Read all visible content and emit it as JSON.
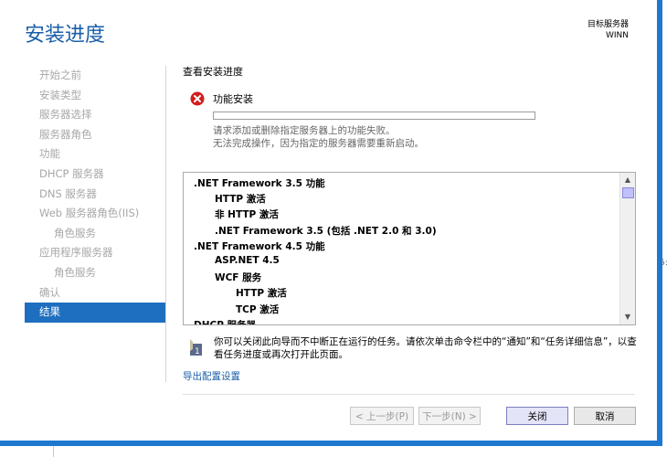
{
  "window": {
    "title": "安装进度",
    "server_label": "目标服务器",
    "server_name": "WINN"
  },
  "nav": {
    "items": [
      {
        "label": "开始之前",
        "indent": false,
        "active": false
      },
      {
        "label": "安装类型",
        "indent": false,
        "active": false
      },
      {
        "label": "服务器选择",
        "indent": false,
        "active": false
      },
      {
        "label": "服务器角色",
        "indent": false,
        "active": false
      },
      {
        "label": "功能",
        "indent": false,
        "active": false
      },
      {
        "label": "DHCP 服务器",
        "indent": false,
        "active": false
      },
      {
        "label": "DNS 服务器",
        "indent": false,
        "active": false
      },
      {
        "label": "Web 服务器角色(IIS)",
        "indent": false,
        "active": false
      },
      {
        "label": "角色服务",
        "indent": true,
        "active": false
      },
      {
        "label": "应用程序服务器",
        "indent": false,
        "active": false
      },
      {
        "label": "角色服务",
        "indent": true,
        "active": false
      },
      {
        "label": "确认",
        "indent": false,
        "active": false
      },
      {
        "label": "结果",
        "indent": false,
        "active": true
      }
    ]
  },
  "main": {
    "section_title": "查看安装进度",
    "feature_label": "功能安装",
    "status_icon": "error-x-icon",
    "status_color": "#d31e1e",
    "progress": 0,
    "fail_line1": "请求添加或删除指定服务器上的功能失败。",
    "fail_line2": "无法完成操作，因为指定的服务器需要重新启动。"
  },
  "list": {
    "items": [
      {
        "text": ".NET Framework 3.5 功能",
        "level": 0
      },
      {
        "text": "HTTP 激活",
        "level": 1
      },
      {
        "text": "非 HTTP 激活",
        "level": 1
      },
      {
        "text": ".NET Framework 3.5 (包括 .NET 2.0 和 3.0)",
        "level": 1
      },
      {
        "text": ".NET Framework 4.5 功能",
        "level": 0
      },
      {
        "text": "ASP.NET 4.5",
        "level": 1
      },
      {
        "text": "WCF 服务",
        "level": 1
      },
      {
        "text": "HTTP 激活",
        "level": 2
      },
      {
        "text": "TCP 激活",
        "level": 2
      },
      {
        "text": "DHCP 服务器",
        "level": 0
      }
    ]
  },
  "note": {
    "icon": "flag-note-icon",
    "text": "你可以关闭此向导而不中断正在运行的任务。请依次单击命令栏中的“通知”和“任务详细信息”，以查看任务进度或再次打开此页面。"
  },
  "export_link": "导出配置设置",
  "buttons": {
    "prev": "< 上一步(P)",
    "next": "下一步(N) >",
    "close": "关闭",
    "cancel": "取消"
  },
  "background": {
    "fragment": "5:4"
  },
  "colors": {
    "accent": "#1e6fbf",
    "title": "#1a5ea9",
    "frame": "#1e78d0"
  }
}
